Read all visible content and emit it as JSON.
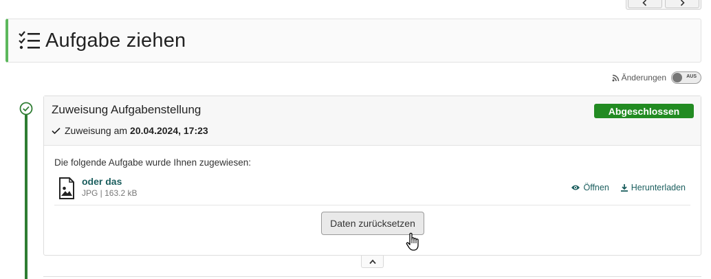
{
  "header": {
    "title": "Aufgabe ziehen",
    "icon": "task-list-icon"
  },
  "nav": {
    "prev_icon": "chevron-left-icon",
    "next_icon": "chevron-right-icon"
  },
  "changes": {
    "label": "Änderungen",
    "toggle_text": "AUS"
  },
  "step": {
    "title": "Zuweisung Aufgabenstellung",
    "status": "Abgeschlossen",
    "assignment_prefix": "Zuweisung am",
    "assignment_date": "20.04.2024, 17:23",
    "intro": "Die folgende Aufgabe wurde Ihnen zugewiesen:",
    "file": {
      "name": "oder das",
      "meta": "JPG | 163.2 kB",
      "open_label": "Öffnen",
      "download_label": "Herunterladen"
    },
    "reset_label": "Daten zurücksetzen"
  },
  "colors": {
    "accent_green": "#5cb85c",
    "timeline_green": "#2e7d32",
    "badge_green": "#228b22",
    "link_teal": "#1b5e5e"
  }
}
